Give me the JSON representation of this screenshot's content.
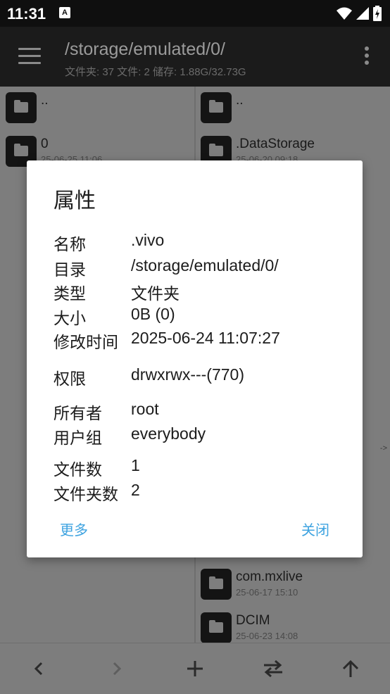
{
  "status_bar": {
    "time": "11:31",
    "notification_glyph": "A"
  },
  "app_bar": {
    "path": "/storage/emulated/0/",
    "summary": "文件夹: 37  文件: 2  储存: 1.88G/32.73G"
  },
  "left_pane": {
    "items": [
      {
        "name": "..",
        "date": ""
      },
      {
        "name": "0",
        "date": "25-06-25 11:06"
      }
    ]
  },
  "right_pane": {
    "items": [
      {
        "name": "..",
        "date": ""
      },
      {
        "name": ".DataStorage",
        "date": "25-06-20 09:18"
      },
      {
        "name": "com.mxlive",
        "date": "25-06-17 15:10"
      },
      {
        "name": "DCIM",
        "date": "25-06-23 14:08"
      }
    ],
    "arrow_hint": "->"
  },
  "dialog": {
    "title": "属性",
    "properties": [
      {
        "label": "名称",
        "value": ".vivo"
      },
      {
        "label": "目录",
        "value": "/storage/emulated/0/"
      },
      {
        "label": "类型",
        "value": "文件夹"
      },
      {
        "label": "大小",
        "value": "0B (0)"
      },
      {
        "label": "修改时间",
        "value": "2025-06-24 11:07:27"
      },
      {
        "label": "权限",
        "value": "drwxrwx---(770)"
      },
      {
        "label": "所有者",
        "value": "root"
      },
      {
        "label": "用户组",
        "value": "everybody"
      },
      {
        "label": "文件数",
        "value": "1"
      },
      {
        "label": "文件夹数",
        "value": "2"
      }
    ],
    "more_label": "更多",
    "close_label": "关闭"
  },
  "bottom_bar": {
    "icons": [
      "back-icon",
      "forward-icon",
      "add-icon",
      "swap-icon",
      "up-icon"
    ]
  },
  "colors": {
    "accent": "#3ea3e0",
    "app_bar": "#1b1b1b",
    "dim_background": "#7d7d7d"
  }
}
